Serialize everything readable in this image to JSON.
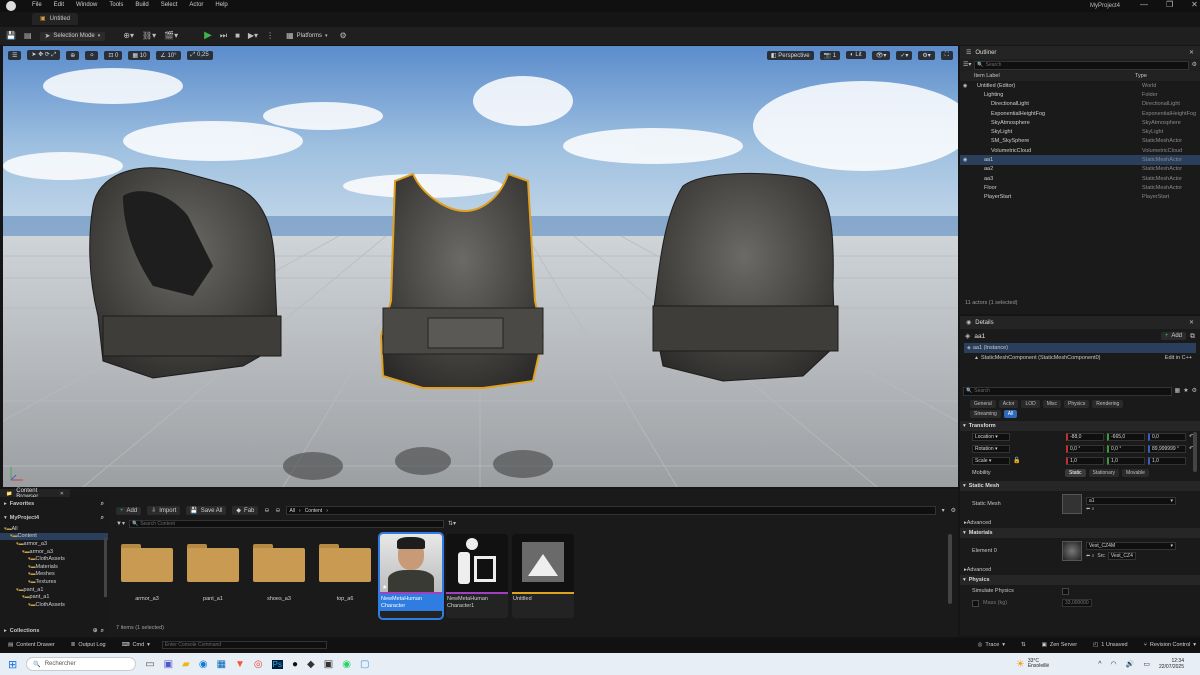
{
  "window": {
    "menu": [
      "File",
      "Edit",
      "Window",
      "Tools",
      "Build",
      "Select",
      "Actor",
      "Help"
    ],
    "project_title": "MyProject4",
    "doc_tab": "Untitled"
  },
  "toolbar": {
    "mode": "Selection Mode",
    "platforms": "Platforms"
  },
  "viewport_toolbar": {
    "rotation_value": "0",
    "grid_value": "10",
    "angle_value": "10°",
    "scale_value": "0,25",
    "perspective": "Perspective",
    "camera_speed": "1",
    "lit": "Lit"
  },
  "outliner": {
    "tab": "Outliner",
    "search_placeholder": "Search",
    "col_label": "Item Label",
    "col_type": "Type",
    "rows": [
      {
        "label": "Untitled (Editor)",
        "type": "World",
        "indent": 1,
        "sel": false
      },
      {
        "label": "Lighting",
        "type": "Folder",
        "indent": 2,
        "sel": false
      },
      {
        "label": "DirectionalLight",
        "type": "DirectionalLight",
        "indent": 3,
        "sel": false
      },
      {
        "label": "ExponentialHeightFog",
        "type": "ExponentialHeightFog",
        "indent": 3,
        "sel": false
      },
      {
        "label": "SkyAtmosphere",
        "type": "SkyAtmosphere",
        "indent": 3,
        "sel": false
      },
      {
        "label": "SkyLight",
        "type": "SkyLight",
        "indent": 3,
        "sel": false
      },
      {
        "label": "SM_SkySphere",
        "type": "StaticMeshActor",
        "indent": 3,
        "sel": false
      },
      {
        "label": "VolumetricCloud",
        "type": "VolumetricCloud",
        "indent": 3,
        "sel": false
      },
      {
        "label": "aa1",
        "type": "StaticMeshActor",
        "indent": 2,
        "sel": true
      },
      {
        "label": "aa2",
        "type": "StaticMeshActor",
        "indent": 2,
        "sel": false
      },
      {
        "label": "aa3",
        "type": "StaticMeshActor",
        "indent": 2,
        "sel": false
      },
      {
        "label": "Floor",
        "type": "StaticMeshActor",
        "indent": 2,
        "sel": false
      },
      {
        "label": "PlayerStart",
        "type": "PlayerStart",
        "indent": 2,
        "sel": false
      }
    ],
    "footer": "11 actors (1 selected)"
  },
  "details": {
    "tab": "Details",
    "actor_name": "aa1",
    "add_label": "Add",
    "instance": "aa1 (Instance)",
    "component": "StaticMeshComponent (StaticMeshComponent0)",
    "edit_cpp": "Edit in C++",
    "search_placeholder": "Search",
    "tabs_row1": [
      "General",
      "Actor",
      "LOD",
      "Misc",
      "Physics",
      "Rendering"
    ],
    "tabs_row2": [
      "Streaming",
      "All"
    ],
    "transform": {
      "title": "Transform",
      "location_label": "Location",
      "location": [
        "-88,0",
        "-665,0",
        "0,0"
      ],
      "rotation_label": "Rotation",
      "rotation": [
        "0,0 °",
        "0,0 °",
        "89,999999 °"
      ],
      "scale_label": "Scale",
      "scale": [
        "1,0",
        "1,0",
        "1,0"
      ],
      "mobility_label": "Mobility",
      "mobility_options": [
        "Static",
        "Stationary",
        "Movable"
      ]
    },
    "static_mesh": {
      "title": "Static Mesh",
      "label": "Static Mesh",
      "value": "a1",
      "advanced": "Advanced"
    },
    "materials": {
      "title": "Materials",
      "label": "Element 0",
      "value": "Vest_CZ4M",
      "src_label": "Src",
      "src_value": "Vest_CZ4",
      "advanced": "Advanced"
    },
    "physics": {
      "title": "Physics",
      "simulate": "Simulate Physics",
      "mass": "Mass (kg)",
      "mass_value": "33,000000"
    }
  },
  "content_browser": {
    "tab": "Content Browser",
    "favorites": "Favorites",
    "project": "MyProject4",
    "collections": "Collections",
    "tree": [
      {
        "label": "All",
        "indent": 0
      },
      {
        "label": "Content",
        "indent": 1
      },
      {
        "label": "armor_a3",
        "indent": 2
      },
      {
        "label": "armor_a3",
        "indent": 3
      },
      {
        "label": "ClothAssets",
        "indent": 4
      },
      {
        "label": "Materials",
        "indent": 4
      },
      {
        "label": "Meshes",
        "indent": 4
      },
      {
        "label": "Textures",
        "indent": 4
      },
      {
        "label": "pant_a1",
        "indent": 2
      },
      {
        "label": "pant_a1",
        "indent": 3
      },
      {
        "label": "ClothAssets",
        "indent": 4
      }
    ],
    "add": "Add",
    "import": "Import",
    "save_all": "Save All",
    "fab": "Fab",
    "path_all": "All",
    "path_content": "Content",
    "search_placeholder": "Search Content",
    "assets": [
      {
        "label": "armor_a3",
        "kind": "folder"
      },
      {
        "label": "pant_a1",
        "kind": "folder"
      },
      {
        "label": "shoes_a3",
        "kind": "folder"
      },
      {
        "label": "top_a6",
        "kind": "folder"
      },
      {
        "label": "NewMetaHuman Character",
        "kind": "photo"
      },
      {
        "label": "NewMetaHuman Character1",
        "kind": "metahuman"
      },
      {
        "label": "Untitled",
        "kind": "level"
      }
    ],
    "status": "7 items (1 selected)"
  },
  "statusbar": {
    "content_drawer": "Content Drawer",
    "output_log": "Output Log",
    "cmd": "Cmd",
    "console_placeholder": "Enter Console Command",
    "trace": "Trace",
    "zen": "Zen Server",
    "unsaved": "1 Unsaved",
    "revision": "Revision Control"
  },
  "taskbar": {
    "search_placeholder": "Rechercher",
    "weather_temp": "33°C",
    "weather_desc": "Ensoleillé",
    "time": "12:34",
    "date": "22/07/2025"
  },
  "colors": {
    "accent": "#3a6ea5",
    "selection": "#2a3f5c",
    "play": "#3bb54a",
    "outline": "#e0a020"
  }
}
